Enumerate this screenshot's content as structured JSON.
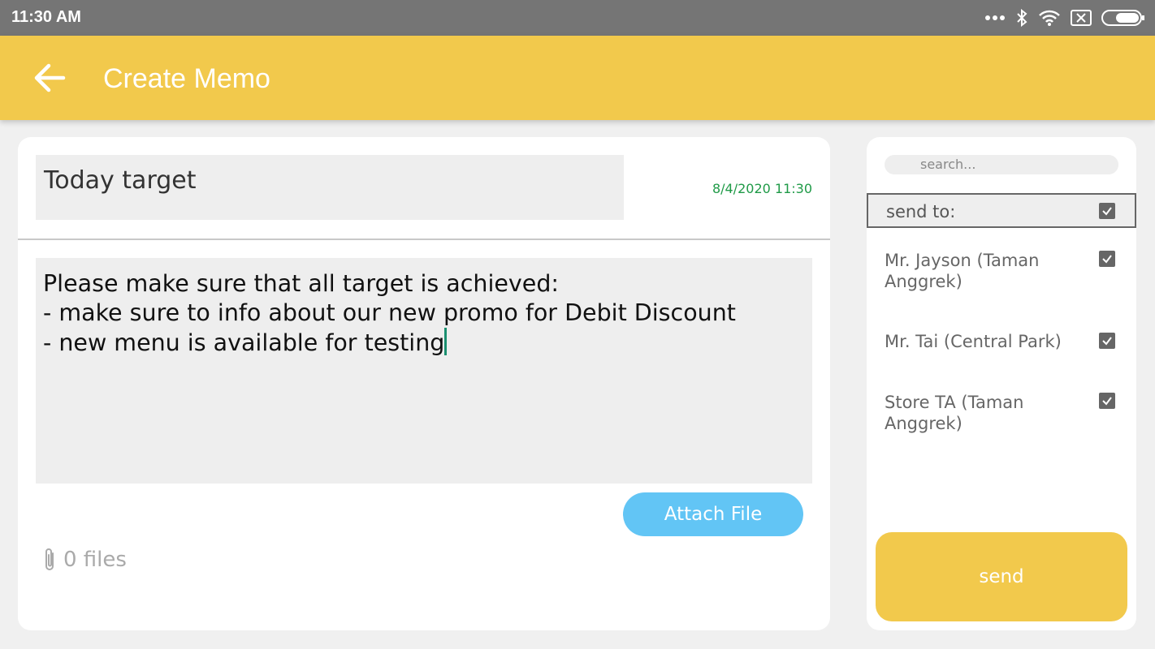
{
  "status_bar": {
    "time": "11:30 AM",
    "icons": [
      "more-dots-icon",
      "bluetooth-icon",
      "wifi-icon",
      "no-sim-icon",
      "battery-icon"
    ]
  },
  "app_bar": {
    "title": "Create Memo",
    "back_icon": "arrow-left-icon",
    "color": "#f2c94c"
  },
  "memo": {
    "subject": "Today target",
    "date": "8/4/2020 11:30",
    "body": "Please make sure that all target is achieved:\n- make sure to info about our new promo for Debit Discount\n- new menu is available for testing",
    "attach_label": "Attach File",
    "files_count": "0 files"
  },
  "recipients_panel": {
    "search_placeholder": "search...",
    "send_to_label": "send to:",
    "send_to_checked": true,
    "recipients": [
      {
        "name": "Mr. Jayson (Taman Anggrek)",
        "checked": true
      },
      {
        "name": "Mr. Tai (Central Park)",
        "checked": true
      },
      {
        "name": "Store TA (Taman Anggrek)",
        "checked": true
      }
    ],
    "send_label": "send"
  },
  "colors": {
    "accent": "#f2c94c",
    "attach_button": "#62c5f5",
    "date_text": "#1f9a47"
  }
}
